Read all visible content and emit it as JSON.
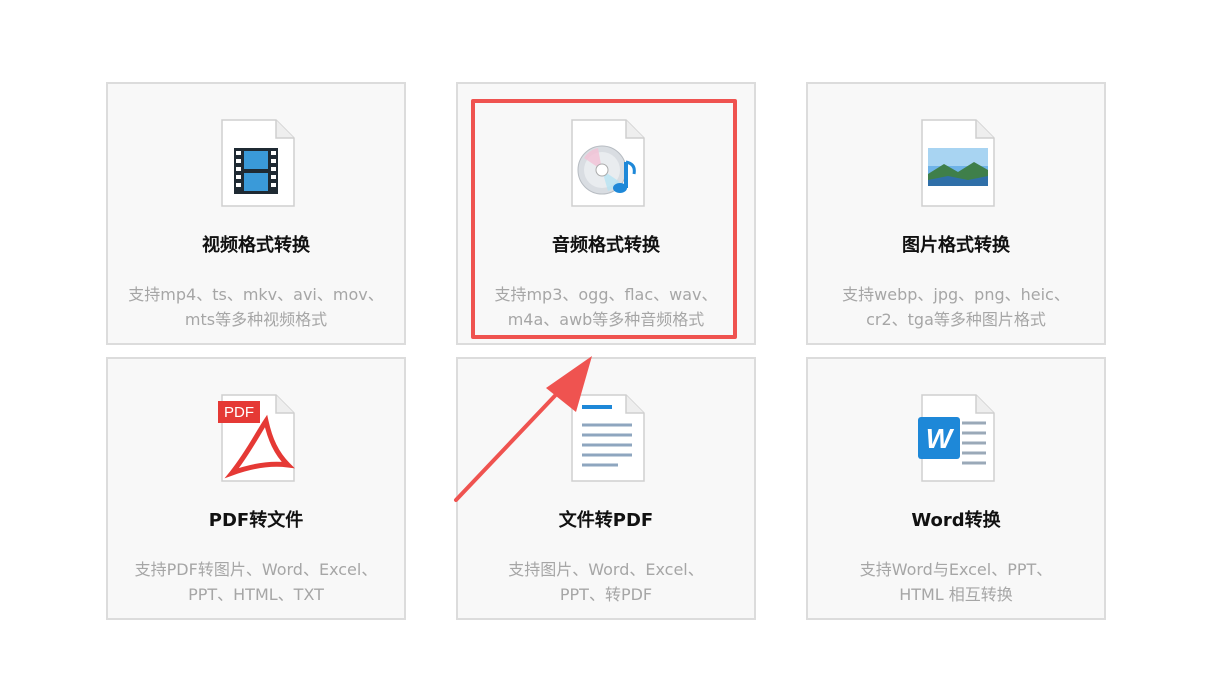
{
  "cards": [
    {
      "title": "视频格式转换",
      "desc": [
        "支持mp4、ts、mkv、avi、mov、",
        "mts等多种视频格式"
      ],
      "icon": "video-file-icon"
    },
    {
      "title": "音频格式转换",
      "desc": [
        "支持mp3、ogg、flac、wav、",
        "m4a、awb等多种音频格式"
      ],
      "icon": "audio-file-icon"
    },
    {
      "title": "图片格式转换",
      "desc": [
        "支持webp、jpg、png、heic、",
        "cr2、tga等多种图片格式"
      ],
      "icon": "image-file-icon"
    },
    {
      "title": "PDF转文件",
      "desc": [
        "支持PDF转图片、Word、Excel、",
        "PPT、HTML、TXT"
      ],
      "icon": "pdf-file-icon",
      "badge": "PDF"
    },
    {
      "title": "文件转PDF",
      "desc": [
        "支持图片、Word、Excel、",
        "PPT、转PDF"
      ],
      "icon": "document-file-icon"
    },
    {
      "title": "Word转换",
      "desc": [
        "支持Word与Excel、PPT、",
        "HTML 相互转换"
      ],
      "icon": "word-file-icon",
      "badge": "W"
    }
  ],
  "colors": {
    "highlight": "#ef5350",
    "card_bg": "#f8f8f8",
    "card_border": "#dcdcdc",
    "desc_text": "#a6a6a6",
    "word_blue": "#1e88d8",
    "pdf_red": "#e53935"
  },
  "highlighted_card": "音频格式转换"
}
